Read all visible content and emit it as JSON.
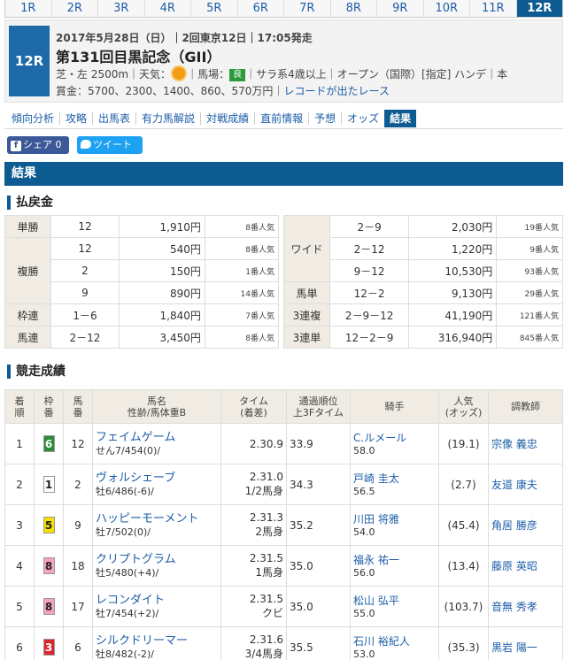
{
  "race_tabs": [
    "1R",
    "2R",
    "3R",
    "4R",
    "5R",
    "6R",
    "7R",
    "8R",
    "9R",
    "10R",
    "11R",
    "12R"
  ],
  "active_tab": "12R",
  "race": {
    "badge": "12R",
    "date_line": "2017年5月28日（日）｜2回東京12日｜17:05発走",
    "title": "第131回目黒記念（GII）",
    "course": "芝・左 2500m",
    "weather_label": "｜天気：",
    "track_label": "｜馬場：",
    "track_state": "良",
    "conditions": "｜サラ系4歳以上｜オープン（国際）[指定] ハンデ｜本",
    "prize": "賞金：5700、2300、1400、860、570万円｜",
    "record_link": "レコードが出たレース"
  },
  "subnav": [
    "傾向分析",
    "攻略",
    "出馬表",
    "有力馬解説",
    "対戦成績",
    "直前情報",
    "予想",
    "オッズ",
    "結果"
  ],
  "social": {
    "share": "シェア 0",
    "tweet": "ツイート"
  },
  "section_result": "結果",
  "section_payout": "払戻金",
  "section_race": "競走成績",
  "payout_left": [
    {
      "label": "単勝",
      "num": "12",
      "amt": "1,910円",
      "pop": "8番人気"
    },
    {
      "label": "複勝",
      "num": "12",
      "amt": "540円",
      "pop": "8番人気"
    },
    {
      "label": "",
      "num": "2",
      "amt": "150円",
      "pop": "1番人気"
    },
    {
      "label": "",
      "num": "9",
      "amt": "890円",
      "pop": "14番人気"
    },
    {
      "label": "枠連",
      "num": "1－6",
      "amt": "1,840円",
      "pop": "7番人気"
    },
    {
      "label": "馬連",
      "num": "2－12",
      "amt": "3,450円",
      "pop": "8番人気"
    }
  ],
  "payout_right": [
    {
      "label": "ワイド",
      "num": "2－9",
      "amt": "2,030円",
      "pop": "19番人気"
    },
    {
      "label": "",
      "num": "2－12",
      "amt": "1,220円",
      "pop": "9番人気"
    },
    {
      "label": "",
      "num": "9－12",
      "amt": "10,530円",
      "pop": "93番人気"
    },
    {
      "label": "馬単",
      "num": "12－2",
      "amt": "9,130円",
      "pop": "29番人気"
    },
    {
      "label": "3連複",
      "num": "2－9－12",
      "amt": "41,190円",
      "pop": "121番人気"
    },
    {
      "label": "3連単",
      "num": "12－2－9",
      "amt": "316,940円",
      "pop": "845番人気"
    }
  ],
  "result_headers": {
    "rank": "着順",
    "waku": "枠番",
    "uma": "馬番",
    "name": "馬名",
    "name_sub": "性齢/馬体重B",
    "time": "タイム",
    "time_sub": "(着差)",
    "pass": "通過順位",
    "pass_sub": "上3Fタイム",
    "jockey": "騎手",
    "pop": "人気",
    "pop_sub": "(オッズ)",
    "trainer": "調教師"
  },
  "results": [
    {
      "rank": "1",
      "waku": "6",
      "waku_bg": "#2e8b3a",
      "waku_fg": "#ffffff",
      "uma": "12",
      "name": "フェイムゲーム",
      "sub": "せん7/454(0)/",
      "time": "2.30.9",
      "margin": "",
      "f3": "33.9",
      "jockey": "C.ルメール",
      "weight": "58.0",
      "odds": "(19.1)",
      "trainer": "宗像 義忠"
    },
    {
      "rank": "2",
      "waku": "1",
      "waku_bg": "#ffffff",
      "waku_fg": "#222222",
      "uma": "2",
      "name": "ヴォルシェーブ",
      "sub": "牡6/486(-6)/",
      "time": "2.31.0",
      "margin": "1/2馬身",
      "f3": "34.3",
      "jockey": "戸崎 圭太",
      "weight": "56.5",
      "odds": "(2.7)",
      "trainer": "友道 康夫"
    },
    {
      "rank": "3",
      "waku": "5",
      "waku_bg": "#f5e000",
      "waku_fg": "#222222",
      "uma": "9",
      "name": "ハッピーモーメント",
      "sub": "牡7/502(0)/",
      "time": "2.31.3",
      "margin": "2馬身",
      "f3": "35.2",
      "jockey": "川田 将雅",
      "weight": "54.0",
      "odds": "(45.4)",
      "trainer": "角居 勝彦"
    },
    {
      "rank": "4",
      "waku": "8",
      "waku_bg": "#f7a1c4",
      "waku_fg": "#222222",
      "uma": "18",
      "name": "クリプトグラム",
      "sub": "牡5/480(+4)/",
      "time": "2.31.5",
      "margin": "1馬身",
      "f3": "35.0",
      "jockey": "福永 祐一",
      "weight": "56.0",
      "odds": "(13.4)",
      "trainer": "藤原 英昭"
    },
    {
      "rank": "5",
      "waku": "8",
      "waku_bg": "#f7a1c4",
      "waku_fg": "#222222",
      "uma": "17",
      "name": "レコンダイト",
      "sub": "牡7/454(+2)/",
      "time": "2.31.5",
      "margin": "クビ",
      "f3": "35.0",
      "jockey": "松山 弘平",
      "weight": "55.0",
      "odds": "(103.7)",
      "trainer": "音無 秀孝"
    },
    {
      "rank": "6",
      "waku": "3",
      "waku_bg": "#d9272e",
      "waku_fg": "#ffffff",
      "uma": "6",
      "name": "シルクドリーマー",
      "sub": "牡8/482(-2)/",
      "time": "2.31.6",
      "margin": "3/4馬身",
      "f3": "35.5",
      "jockey": "石川 裕紀人",
      "weight": "53.0",
      "odds": "(35.3)",
      "trainer": "黒岩 陽一"
    }
  ]
}
